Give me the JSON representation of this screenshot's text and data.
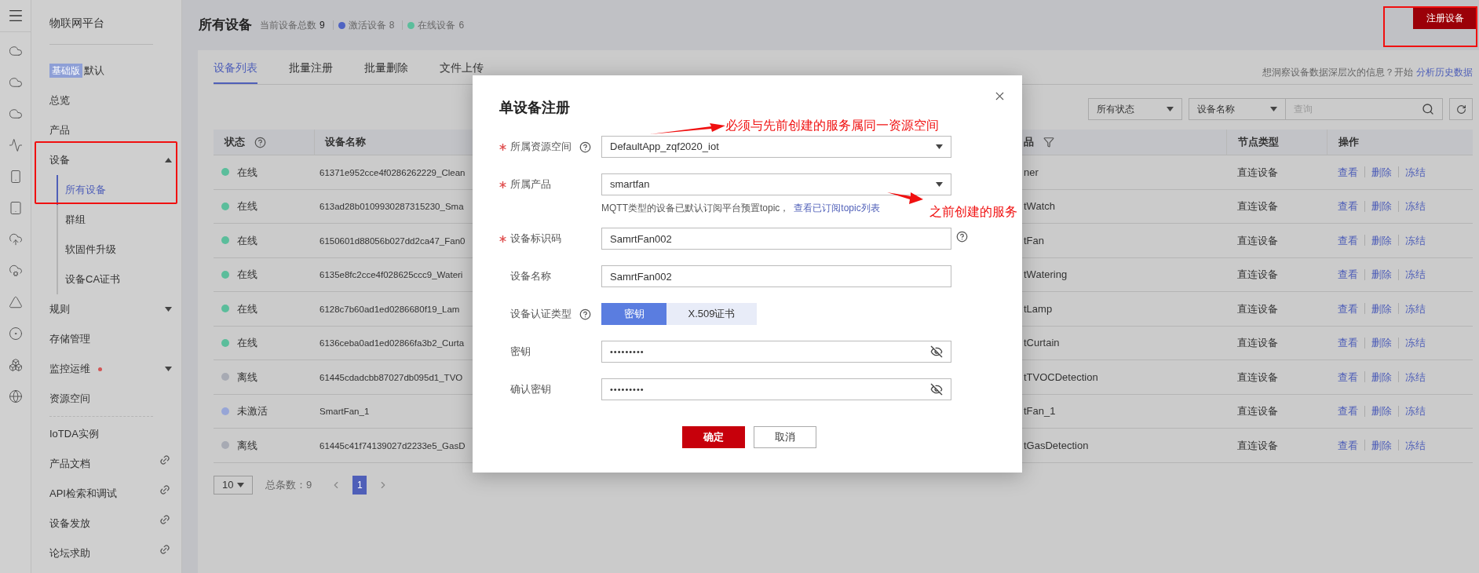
{
  "sidebar": {
    "title": "物联网平台",
    "edition": {
      "badge": "基础版",
      "label": "默认"
    },
    "items": [
      {
        "kind": "link",
        "label": "总览",
        "selected": false
      },
      {
        "kind": "link",
        "label": "产品",
        "selected": false
      },
      {
        "kind": "group",
        "label": "设备",
        "selected": false,
        "expanded": true,
        "alert": false,
        "children": [
          {
            "label": "所有设备",
            "selected": true
          },
          {
            "label": "群组",
            "selected": false
          },
          {
            "label": "软固件升级",
            "selected": false
          },
          {
            "label": "设备CA证书",
            "selected": false
          }
        ]
      },
      {
        "kind": "group",
        "label": "规则",
        "selected": false,
        "expanded": false,
        "alert": false
      },
      {
        "kind": "link",
        "label": "存储管理",
        "selected": false
      },
      {
        "kind": "group",
        "label": "监控运维",
        "selected": false,
        "expanded": false,
        "alert": true
      },
      {
        "kind": "link",
        "label": "资源空间",
        "selected": false
      }
    ],
    "links": [
      {
        "label": "IoTDA实例",
        "external": false
      },
      {
        "label": "产品文档",
        "external": true
      },
      {
        "label": "API检索和调试",
        "external": true
      },
      {
        "label": "设备发放",
        "external": true
      },
      {
        "label": "论坛求助",
        "external": true
      }
    ]
  },
  "header": {
    "title": "所有设备",
    "stats": [
      {
        "label": "当前设备总数",
        "value": "9"
      },
      {
        "label": "激活设备",
        "value": "8",
        "color": "#4f63c2"
      },
      {
        "label": "在线设备",
        "value": "6",
        "color": "#5bbd9b"
      }
    ],
    "register_button": "注册设备"
  },
  "tabs": [
    {
      "label": "设备列表",
      "selected": true
    },
    {
      "label": "批量注册",
      "selected": false
    },
    {
      "label": "批量删除",
      "selected": false
    },
    {
      "label": "文件上传",
      "selected": false
    }
  ],
  "insight": {
    "text": "想洞察设备数据深层次的信息？开始",
    "link": "分析历史数据"
  },
  "filters": {
    "status": "所有状态",
    "field": "设备名称",
    "search_placeholder": "查询"
  },
  "table": {
    "columns": [
      {
        "label": "状态",
        "help": true
      },
      {
        "label": "设备名称"
      },
      {
        "label": "品",
        "filter": true
      },
      {
        "label": "节点类型"
      },
      {
        "label": "操作"
      }
    ],
    "rows": [
      {
        "status": "在线",
        "color": "#5bbd9b",
        "name": "61371e952cce4f0286262229_Clean",
        "product": "ner",
        "node_type": "直连设备",
        "actions": [
          "查看",
          "删除",
          "冻结"
        ]
      },
      {
        "status": "在线",
        "color": "#5bbd9b",
        "name": "613ad28b0109930287315230_Sma",
        "product": "tWatch",
        "node_type": "直连设备",
        "actions": [
          "查看",
          "删除",
          "冻结"
        ]
      },
      {
        "status": "在线",
        "color": "#5bbd9b",
        "name": "6150601d88056b027dd2ca47_Fan0",
        "product": "tFan",
        "node_type": "直连设备",
        "actions": [
          "查看",
          "删除",
          "冻结"
        ]
      },
      {
        "status": "在线",
        "color": "#5bbd9b",
        "name": "6135e8fc2cce4f028625ccc9_Wateri",
        "product": "tWatering",
        "node_type": "直连设备",
        "actions": [
          "查看",
          "删除",
          "冻结"
        ]
      },
      {
        "status": "在线",
        "color": "#5bbd9b",
        "name": "6128c7b60ad1ed0286680f19_Lam",
        "product": "tLamp",
        "node_type": "直连设备",
        "actions": [
          "查看",
          "删除",
          "冻结"
        ]
      },
      {
        "status": "在线",
        "color": "#5bbd9b",
        "name": "6136ceba0ad1ed02866fa3b2_Curta",
        "product": "tCurtain",
        "node_type": "直连设备",
        "actions": [
          "查看",
          "删除",
          "冻结"
        ]
      },
      {
        "status": "离线",
        "color": "#a7aab3",
        "name": "61445cdadcbb87027db095d1_TVO",
        "product": "tTVOCDetection",
        "node_type": "直连设备",
        "actions": [
          "查看",
          "删除",
          "冻结"
        ]
      },
      {
        "status": "未激活",
        "color": "#97a5d6",
        "name": "SmartFan_1",
        "product": "tFan_1",
        "node_type": "直连设备",
        "actions": [
          "查看",
          "删除",
          "冻结"
        ]
      },
      {
        "status": "离线",
        "color": "#a7aab3",
        "name": "61445c41f74139027d2233e5_GasD",
        "product": "tGasDetection",
        "node_type": "直连设备",
        "actions": [
          "查看",
          "删除",
          "冻结"
        ]
      }
    ]
  },
  "pagination": {
    "page_size": "10",
    "total": "总条数：9",
    "pages": [
      {
        "label": "1",
        "selected": true
      }
    ]
  },
  "modal": {
    "title": "单设备注册",
    "fields": [
      {
        "kind": "select",
        "label": "所属资源空间",
        "required": true,
        "help": true,
        "value": "DefaultApp_zqf2020_iot"
      },
      {
        "kind": "select",
        "label": "所属产品",
        "required": true,
        "value": "smartfan",
        "hint": "MQTT类型的设备已默认订阅平台预置topic，",
        "hint_link": "查看已订阅topic列表"
      },
      {
        "kind": "text",
        "label": "设备标识码",
        "required": true,
        "help": true,
        "value": "SamrtFan002"
      },
      {
        "kind": "text",
        "label": "设备名称",
        "value": "SamrtFan002"
      },
      {
        "kind": "toggle",
        "label": "设备认证类型",
        "help": true,
        "options": [
          {
            "label": "密钥",
            "selected": true
          },
          {
            "label": "X.509证书",
            "selected": false
          }
        ]
      },
      {
        "kind": "password",
        "label": "密钥",
        "value": "•••••••••"
      },
      {
        "kind": "password",
        "label": "确认密钥",
        "value": "•••••••••"
      }
    ],
    "confirm": "确定",
    "cancel": "取消"
  },
  "annotations": [
    {
      "text": "必须与先前创建的服务属同一资源空间"
    },
    {
      "text": "之前创建的服务"
    }
  ]
}
